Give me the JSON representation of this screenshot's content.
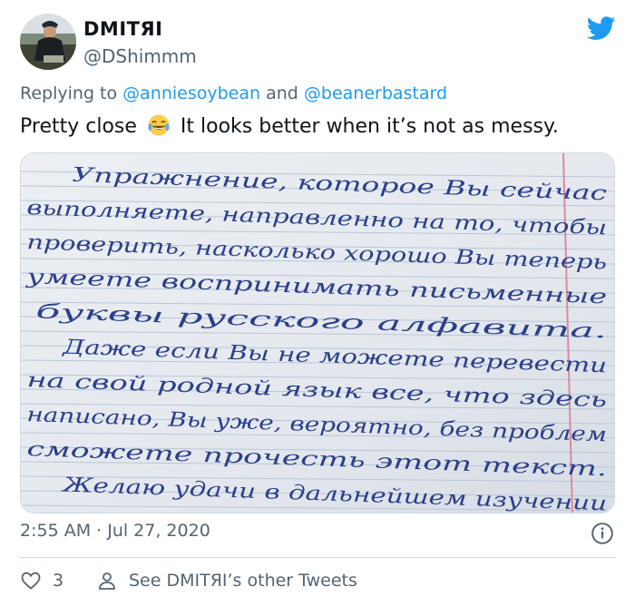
{
  "author": {
    "display_name": "DMITЯI",
    "handle": "@DShimmm"
  },
  "brand": {
    "logo_icon": "twitter-bird-icon",
    "color": "#1d9bf0"
  },
  "reply_context": {
    "prefix": "Replying to ",
    "mention_1": "@anniesoybean",
    "conjunction": " and ",
    "mention_2": "@beanerbastard"
  },
  "tweet": {
    "text_before_emoji": "Pretty close",
    "emoji_icon": "tears-of-joy-emoji",
    "text_after_emoji": "It looks better when it’s not as messy."
  },
  "media": {
    "lines": [
      "Упражнение, которое Вы сейчас",
      "выполняете, направленно на то, чтобы",
      "проверить, насколько хорошо Вы теперь",
      "умеете воспринимать письменные",
      "буквы русского алфавита.",
      "Даже если Вы не можете перевести",
      "на свой родной язык все, что здесь",
      "написано, Вы уже, вероятно, без проблем",
      "сможете прочесть этот текст.",
      "Желаю удачи в дальнейшем изучении"
    ]
  },
  "meta": {
    "timestamp": "2:55 AM · Jul 27, 2020",
    "info_icon": "info-icon"
  },
  "actions": {
    "like_count": "3",
    "like_icon": "heart-icon",
    "see_other_label": "See DMITЯI’s other Tweets",
    "see_other_icon": "person-icon"
  }
}
